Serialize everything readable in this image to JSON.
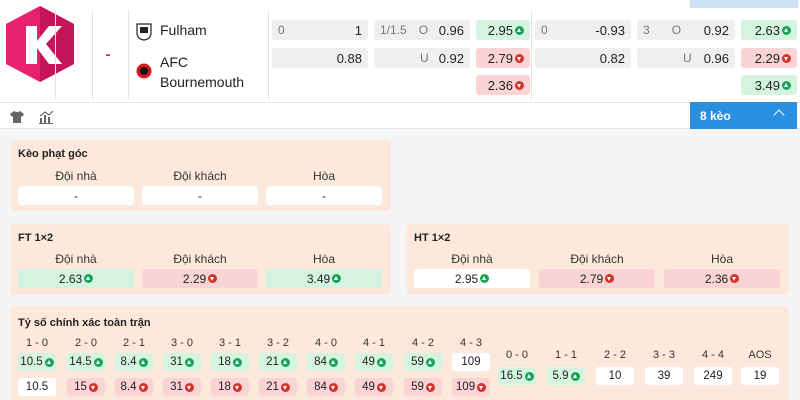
{
  "match": {
    "home_team": "Fulham",
    "away_team": "AFC Bournemouth",
    "score_dash": "-",
    "handicap_ft": {
      "home_line": "0",
      "home_odds": "1",
      "away_odds": "0.88"
    },
    "over_under_ft": {
      "line": "1/1.5",
      "over_label": "O",
      "over_odds": "0.96",
      "under_label": "U",
      "under_odds": "0.92"
    },
    "x12_ft": {
      "home": "2.95",
      "away": "2.79",
      "draw": "2.36"
    },
    "handicap_ht": {
      "home_line": "0",
      "home_odds": "-0.93",
      "away_odds": "0.82"
    },
    "over_under_ht": {
      "line": "3",
      "over_label": "O",
      "over_odds": "0.92",
      "under_label": "U",
      "under_odds": "0.96"
    },
    "x12_ht": {
      "home": "2.63",
      "away": "2.29",
      "draw": "3.49"
    }
  },
  "toolbar": {
    "keo_button": "8 kèo"
  },
  "corner_panel": {
    "title": "Kèo phạt góc",
    "headers": [
      "Đội nhà",
      "Đội khách",
      "Hòa"
    ],
    "values": [
      "-",
      "-",
      "-"
    ]
  },
  "ft_panel": {
    "title": "FT 1×2",
    "headers": [
      "Đội nhà",
      "Đội khách",
      "Hòa"
    ],
    "values": [
      "2.63",
      "2.29",
      "3.49"
    ]
  },
  "ht_panel": {
    "title": "HT 1×2",
    "headers": [
      "Đội nhà",
      "Đội khách",
      "Hòa"
    ],
    "values": [
      "2.95",
      "2.79",
      "2.36"
    ]
  },
  "correct_score": {
    "title": "Tỷ số chính xác toàn trận",
    "scores": [
      "1 - 0",
      "2 - 0",
      "2 - 1",
      "3 - 0",
      "3 - 1",
      "3 - 2",
      "4 - 0",
      "4 - 1",
      "4 - 2",
      "4 - 3"
    ],
    "home_odds": [
      "10.5",
      "14.5",
      "8.4",
      "31",
      "18",
      "21",
      "84",
      "49",
      "59",
      "109"
    ],
    "away_odds": [
      "10.5",
      "15",
      "8.4",
      "31",
      "18",
      "21",
      "84",
      "49",
      "59",
      "109"
    ],
    "draw_scores": [
      "0 - 0",
      "1 - 1",
      "2 - 2",
      "3 - 3",
      "4 - 4",
      "AOS"
    ],
    "draw_odds": [
      "16.5",
      "5.9",
      "10",
      "39",
      "249",
      "19"
    ]
  },
  "colors": {
    "accent": "#2b8fe0",
    "up": "#1aa45a",
    "down": "#d0342c",
    "panel": "#fde9db",
    "green_cell": "#d4f4e0",
    "red_cell": "#fad4d4"
  }
}
